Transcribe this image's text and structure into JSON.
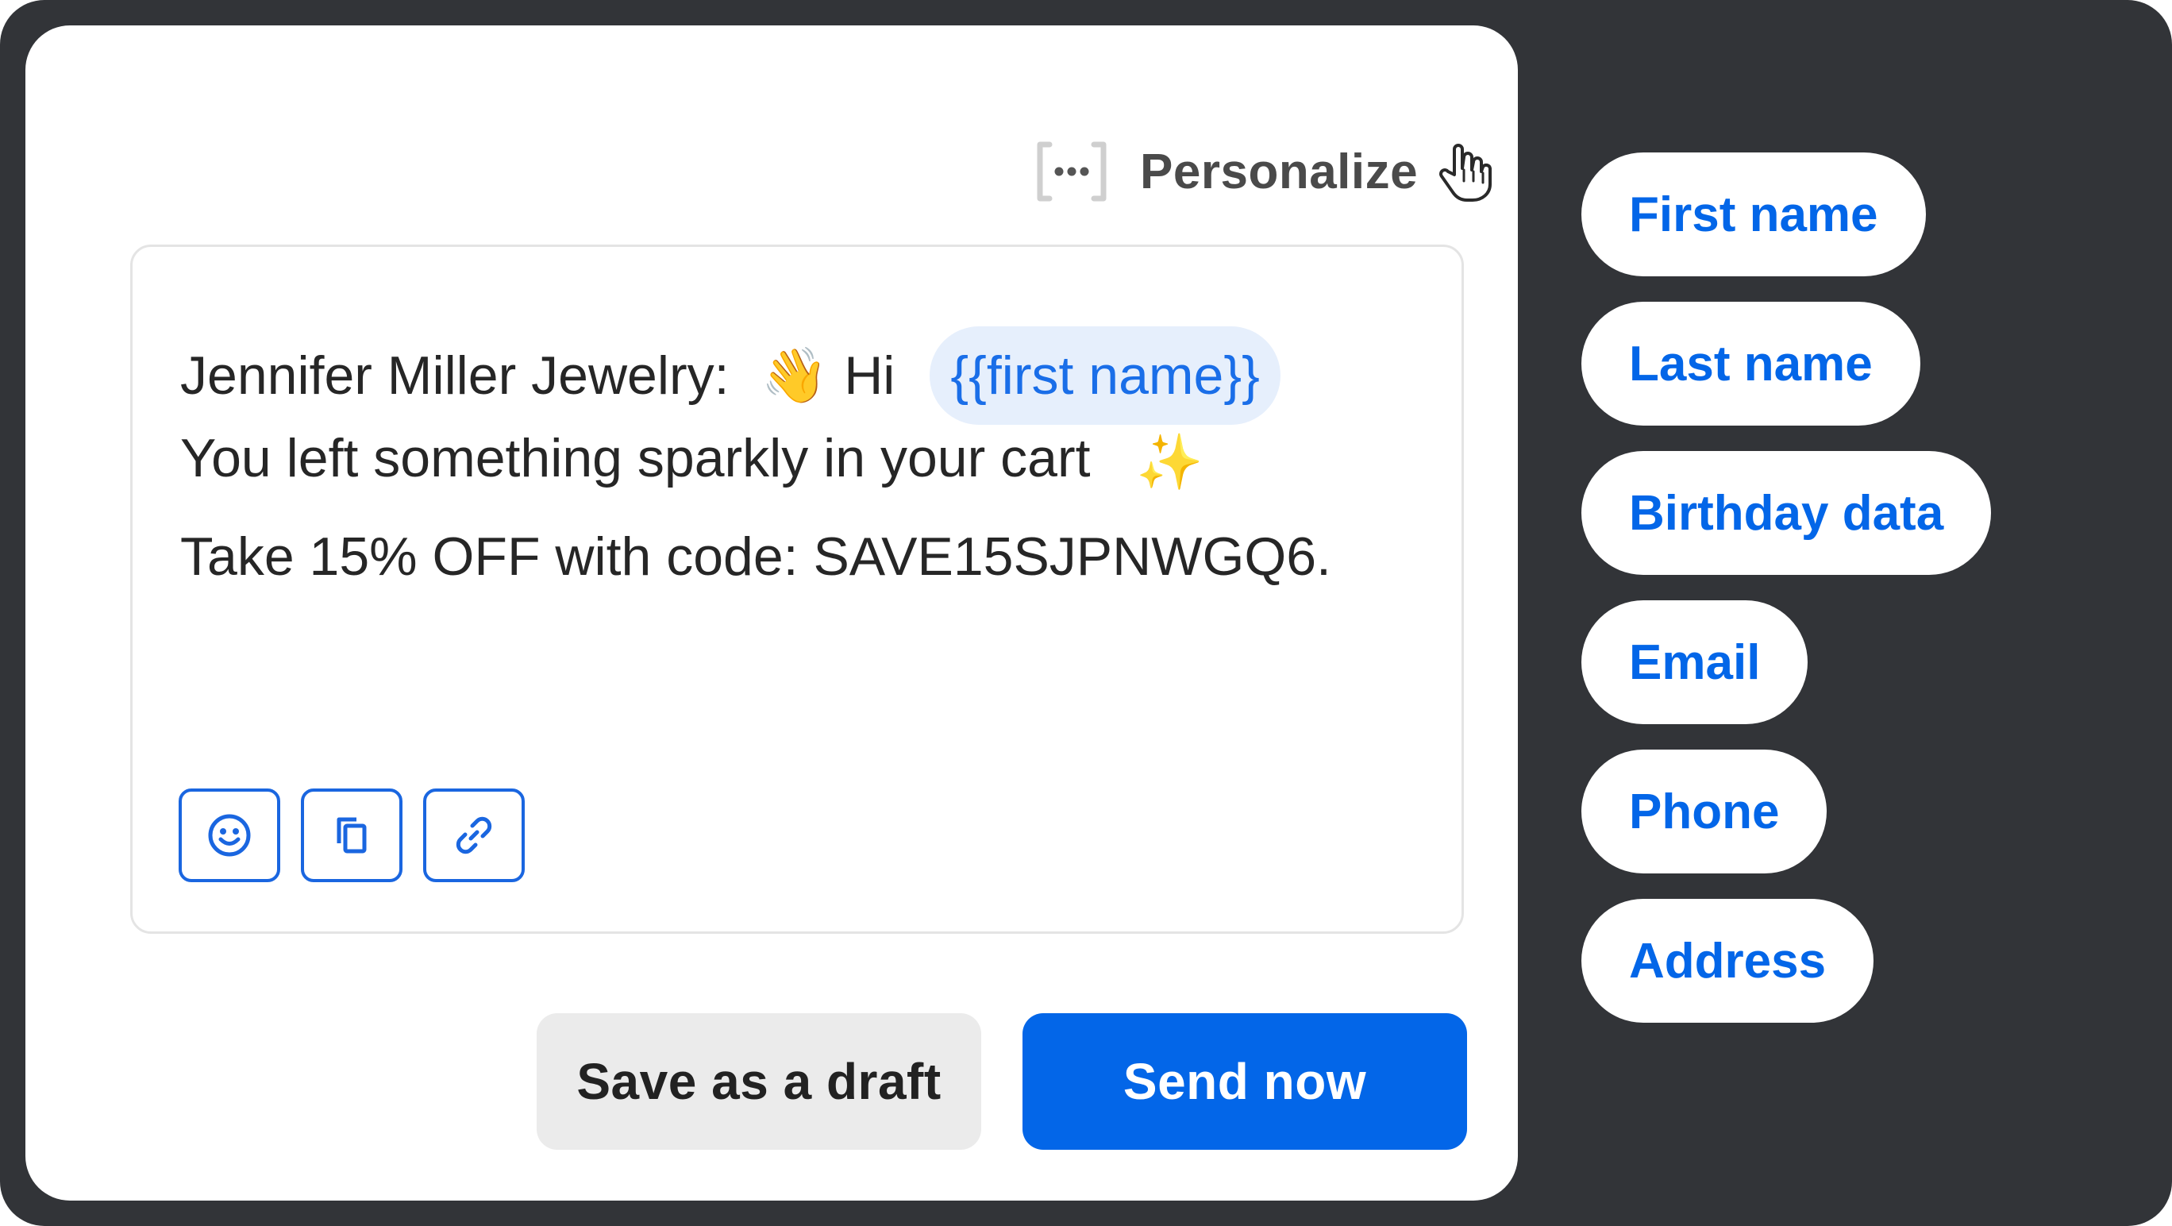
{
  "personalize": {
    "label": "Personalize",
    "icon": "bracket-dots-icon",
    "pointer_icon": "hand-pointer-icon"
  },
  "message": {
    "sender": "Jennifer Miller Jewelry:",
    "wave_emoji": "👋",
    "greeting": "Hi",
    "token": "{{first name}}",
    "line2": "You left something sparkly in your cart",
    "sparkles_emoji": "✨",
    "line3": "Take 15% OFF with code: SAVE15SJPNWGQ6."
  },
  "toolbar": {
    "icons": [
      "emoji-icon",
      "copy-icon",
      "link-icon"
    ]
  },
  "actions": {
    "draft_label": "Save as a draft",
    "send_label": "Send now"
  },
  "fields": [
    {
      "label": "First name"
    },
    {
      "label": "Last name"
    },
    {
      "label": "Birthday data"
    },
    {
      "label": "Email"
    },
    {
      "label": "Phone"
    },
    {
      "label": "Address"
    }
  ],
  "colors": {
    "frame": "#323438",
    "accent": "#0366e8",
    "token_bg": "#e6effc",
    "draft_bg": "#ebebeb"
  }
}
